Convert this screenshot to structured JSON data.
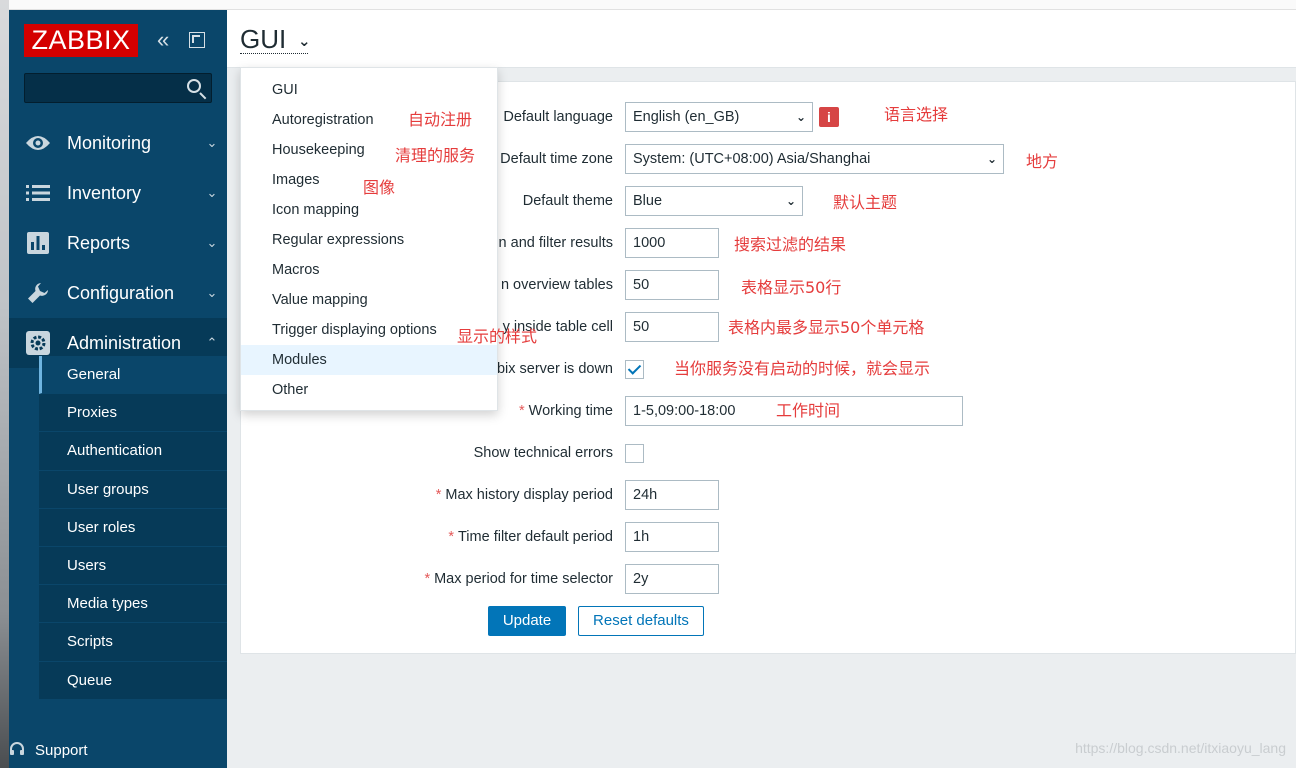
{
  "sidebar": {
    "logo": "ZABBIX",
    "collapse_icon": "«",
    "search_placeholder": "",
    "menu": [
      {
        "label": "Monitoring",
        "icon": "eye-icon",
        "arrow": "⌄"
      },
      {
        "label": "Inventory",
        "icon": "list-icon",
        "arrow": "⌄"
      },
      {
        "label": "Reports",
        "icon": "bar-chart-icon",
        "arrow": "⌄"
      },
      {
        "label": "Configuration",
        "icon": "wrench-icon",
        "arrow": "⌄"
      },
      {
        "label": "Administration",
        "icon": "gear-icon",
        "arrow": "⌃"
      }
    ],
    "submenu": [
      "General",
      "Proxies",
      "Authentication",
      "User groups",
      "User roles",
      "Users",
      "Media types",
      "Scripts",
      "Queue"
    ],
    "support": "Support"
  },
  "header": {
    "title": "GUI",
    "arrow": "⌄"
  },
  "dropdown": [
    "GUI",
    "Autoregistration",
    "Housekeeping",
    "Images",
    "Icon mapping",
    "Regular expressions",
    "Macros",
    "Value mapping",
    "Trigger displaying options",
    "Modules",
    "Other"
  ],
  "form": {
    "rows": [
      {
        "label": "Default language",
        "value": "English (en_GB)",
        "required": false
      },
      {
        "label": "Default time zone",
        "value": "System: (UTC+08:00) Asia/Shanghai",
        "required": false
      },
      {
        "label": "Default theme",
        "value": "Blue",
        "required": false
      },
      {
        "label": "n and filter results",
        "value": "1000",
        "required": false
      },
      {
        "label": "n overview tables",
        "value": "50",
        "required": false
      },
      {
        "label": "y inside table cell",
        "value": "50",
        "required": false
      },
      {
        "label": "bix server is down",
        "checked": true,
        "required": false
      },
      {
        "label": "Working time",
        "value": "1-5,09:00-18:00",
        "required": true
      },
      {
        "label": "Show technical errors",
        "checked": false,
        "required": false
      },
      {
        "label": "Max history display period",
        "value": "24h",
        "required": true
      },
      {
        "label": "Time filter default period",
        "value": "1h",
        "required": true
      },
      {
        "label": "Max period for time selector",
        "value": "2y",
        "required": true
      }
    ],
    "required_mark": "*",
    "info_icon": "i",
    "update_label": "Update",
    "reset_label": "Reset defaults"
  },
  "annotations": {
    "autoreg": "自动注册",
    "housekeeping": "清理的服务",
    "images": "图像",
    "trigger_style": "显示的样式",
    "language": "语言选择",
    "timezone": "地方",
    "theme": "默认主题",
    "search_results": "搜索过滤的结果",
    "table_rows": "表格显示50行",
    "table_cells": "表格内最多显示50个单元格",
    "server_down": "当你服务没有启动的时候，就会显示",
    "working_time": "工作时间"
  },
  "watermark": "https://blog.csdn.net/itxiaoyu_lang",
  "colors": {
    "sidebar_bg": "#0a466a",
    "logo_red": "#d40000",
    "primary_blue": "#0275b8",
    "annotation_red": "#e53c3c"
  }
}
